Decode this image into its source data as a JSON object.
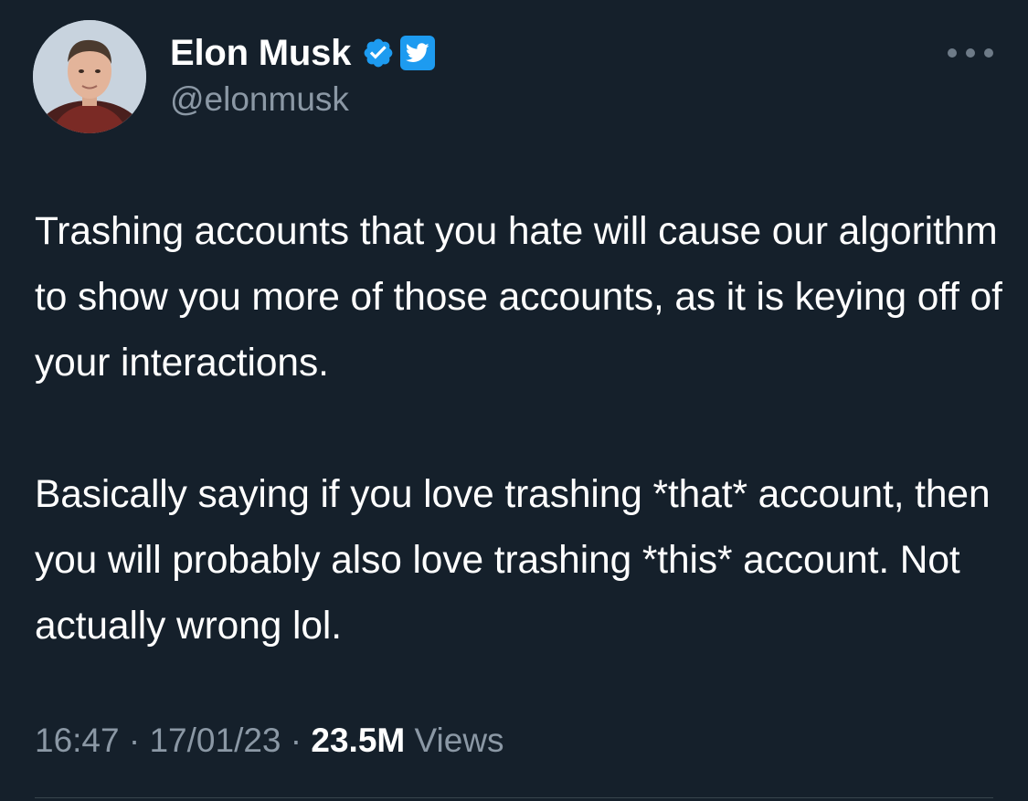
{
  "author": {
    "name": "Elon Musk",
    "handle": "@elonmusk",
    "verified_color": "#1d9bf0",
    "icons": [
      "verified-badge-icon",
      "twitter-bird-icon"
    ]
  },
  "tweet": {
    "paragraphs": [
      "Trashing accounts that you hate will cause our algorithm to show you more of those accounts, as it is keying off of your interactions.",
      "Basically saying if you love trashing *that* account, then you will probably also love trashing *this* account. Not actually wrong lol."
    ]
  },
  "meta": {
    "time": "16:47",
    "separator": "·",
    "date": "17/01/23",
    "views_count": "23.5M",
    "views_label": "Views"
  },
  "colors": {
    "background": "#15202b",
    "text_primary": "#ffffff",
    "text_secondary": "#8b98a5",
    "accent": "#1d9bf0"
  }
}
